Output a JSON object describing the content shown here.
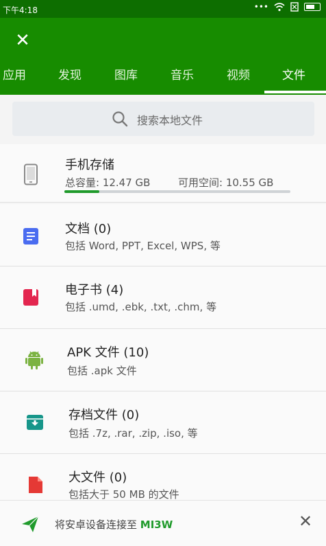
{
  "status_bar": {
    "time": "下午4:18",
    "signal_text": "•••"
  },
  "header": {
    "close_icon": "close-icon",
    "tabs": [
      {
        "label": "应用"
      },
      {
        "label": "发现"
      },
      {
        "label": "图库"
      },
      {
        "label": "音乐"
      },
      {
        "label": "视频"
      },
      {
        "label": "文件",
        "active": true
      }
    ]
  },
  "search": {
    "placeholder": "搜索本地文件"
  },
  "storage": {
    "title": "手机存储",
    "total": "总容量: 12.47 GB",
    "available": "可用空间: 10.55 GB",
    "used_fraction": 0.154
  },
  "categories": [
    {
      "title": "文档 (0)",
      "subtitle": "包括 Word, PPT, Excel, WPS, 等",
      "icon": "document-icon",
      "color": "#4a6cf0"
    },
    {
      "title": "电子书 (4)",
      "subtitle": "包括 .umd, .ebk, .txt, .chm, 等",
      "icon": "ebook-icon",
      "color": "#e3264f"
    },
    {
      "title": "APK 文件 (10)",
      "subtitle": "包括 .apk 文件",
      "icon": "android-icon",
      "color": "#7cb342"
    },
    {
      "title": "存档文件 (0)",
      "subtitle": "包括 .7z, .rar, .zip, .iso, 等",
      "icon": "archive-icon",
      "color": "#17968a"
    },
    {
      "title": "大文件 (0)",
      "subtitle": "包括大于 50 MB 的文件",
      "icon": "large-file-icon",
      "color": "#e53935"
    }
  ],
  "bottom": {
    "connect_prefix": "将安卓设备连接至 ",
    "device": "MI3W"
  },
  "colors": {
    "header_green": "#178c00",
    "status_green": "#0d6e00",
    "accent_green": "#1f9a2b"
  }
}
